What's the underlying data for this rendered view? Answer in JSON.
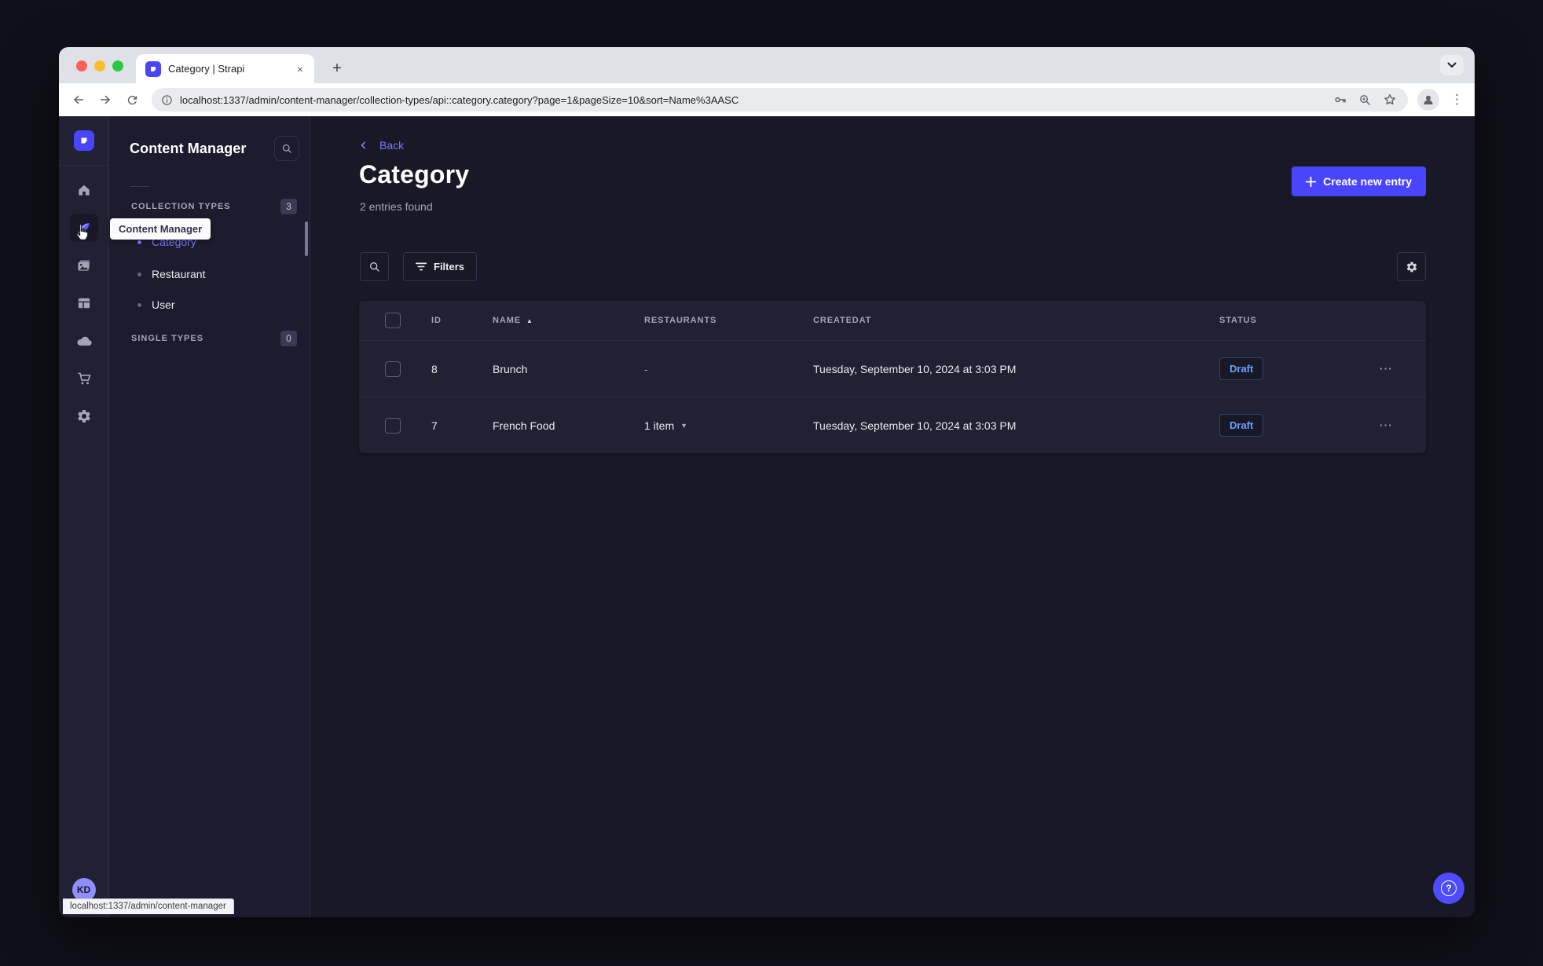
{
  "browser": {
    "tab_title": "Category | Strapi",
    "url": "localhost:1337/admin/content-manager/collection-types/api::category.category?page=1&pageSize=10&sort=Name%3AASC",
    "status_link": "localhost:1337/admin/content-manager",
    "new_tab_label": "+",
    "close_tab_label": "×",
    "menu_dots": "⋮"
  },
  "rail": {
    "workspace_initials": "KD",
    "icons": [
      "home",
      "content-manager",
      "media-library",
      "content-type-builder",
      "deploy",
      "marketplace",
      "settings"
    ],
    "active_icon": "content-manager"
  },
  "panel": {
    "title": "Content Manager",
    "tooltip": "Content Manager",
    "collection_types": {
      "label": "COLLECTION TYPES",
      "count": "3",
      "items": [
        {
          "label": "Category",
          "active": true
        },
        {
          "label": "Restaurant",
          "active": false
        },
        {
          "label": "User",
          "active": false
        }
      ]
    },
    "single_types": {
      "label": "SINGLE TYPES",
      "count": "0"
    }
  },
  "main": {
    "back_label": "Back",
    "title": "Category",
    "subtitle": "2 entries found",
    "create_button_label": "Create new entry",
    "filters_button_label": "Filters",
    "table": {
      "headers": {
        "id": "ID",
        "name": "NAME",
        "restaurants": "RESTAURANTS",
        "createdat": "CREATEDAT",
        "status": "STATUS"
      },
      "sorted_by": "NAME ascending",
      "sort_caret": "▲",
      "dropdown_caret": "▼",
      "row_menu_glyph": "⋯",
      "rows": [
        {
          "id": "8",
          "name": "Brunch",
          "restaurants": "-",
          "createdat": "Tuesday, September 10, 2024 at 3:03 PM",
          "status": "Draft"
        },
        {
          "id": "7",
          "name": "French Food",
          "restaurants": "1 item",
          "createdat": "Tuesday, September 10, 2024 at 3:03 PM",
          "status": "Draft"
        }
      ]
    },
    "help_glyph": "?"
  },
  "colors": {
    "primary": "#4945ff",
    "active_link": "#7b79ff",
    "draft_status": "#6c9eff",
    "surface": "#212134",
    "background": "#181826",
    "border": "#32324d",
    "muted_text": "#a5a5ba"
  }
}
